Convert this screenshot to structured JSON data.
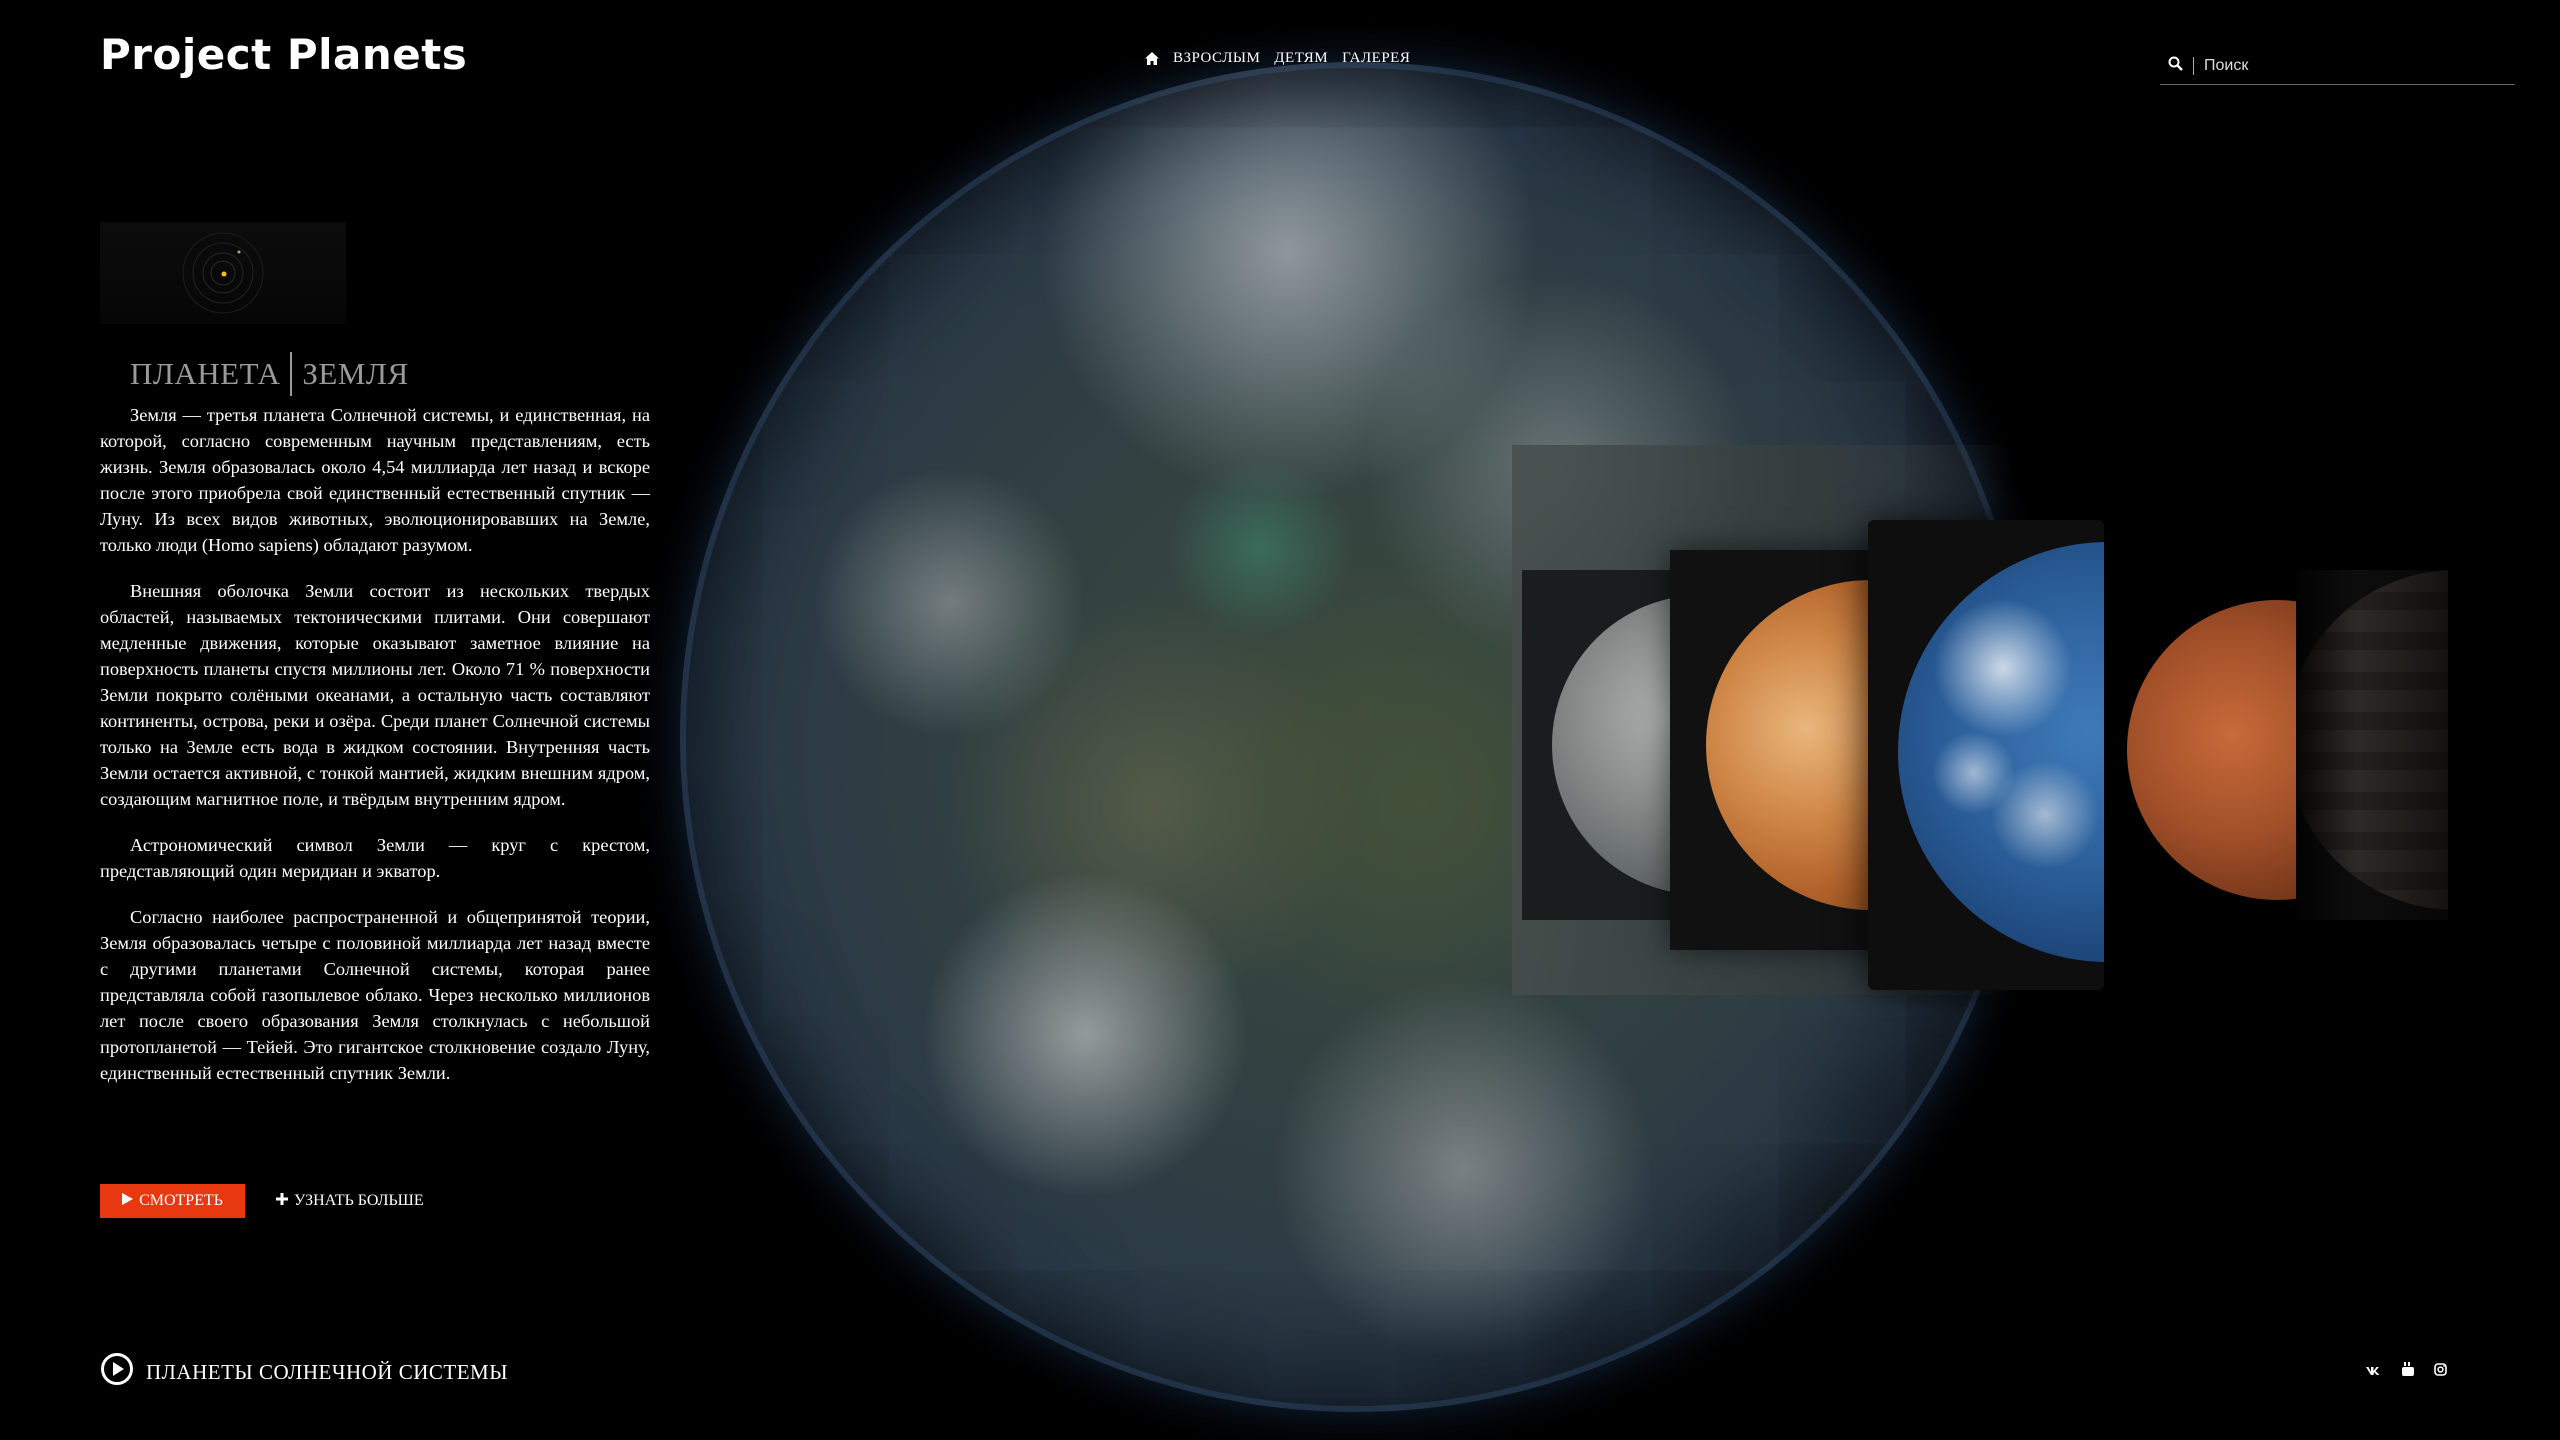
{
  "header": {
    "logo": "Project Planets",
    "nav": [
      "ВЗРОСЛЫМ",
      "ДЕТЯМ",
      "ГАЛЕРЕЯ"
    ],
    "search_placeholder": "Поиск"
  },
  "planet": {
    "label": "ПЛАНЕТА",
    "name": "ЗЕМЛЯ",
    "paragraphs": [
      "Земля — третья планета Солнечной системы, и единственная, на которой, согласно современным научным представлениям, есть жизнь. Земля образовалась около 4,54 миллиарда лет назад и вскоре после этого приобрела свой единственный естественный спутник — Луну. Из всех видов животных, эволюционировавших на Земле, только люди (Homo sapiens) обладают разумом.",
      "Внешняя оболочка Земли состоит из нескольких твердых областей, называемых тектоническими плитами. Они совершают медленные движения, которые оказывают заметное влияние на поверхность планеты спустя миллионы лет. Около 71 % поверхности Земли покрыто солёными океанами, а остальную часть составляют континенты, острова, реки и озёра. Среди планет Солнечной системы только на Земле есть вода в жидком состоянии. Внутренняя часть Земли остается активной, с тонкой мантией, жидким внешним ядром, создающим магнитное поле, и твёрдым внутренним ядром.",
      "Астрономический символ Земли — круг с крестом, представляющий один меридиан и экватор.",
      "Согласно наиболее распространенной и общепринятой теории, Земля образовалась четыре с половиной миллиарда лет назад вместе с другими планетами Солнечной системы, которая ранее представляла собой газопылевое облако. Через несколько миллионов лет после своего образования Земля столкнулась с небольшой протопланетой — Тейей. Это гигантское столкновение создало Луну, единственный естественный спутник Земли."
    ]
  },
  "actions": {
    "watch": "СМОТРЕТЬ",
    "more": "УЗНАТЬ БОЛЬШЕ"
  },
  "footer": {
    "solar_link": "ПЛАНЕТЫ СОЛНЕЧНОЙ СИСТЕМЫ",
    "social": [
      "vk-icon",
      "youtube-icon",
      "instagram-icon"
    ]
  },
  "carousel": [
    "moon",
    "venus",
    "earth",
    "mars",
    "jupiter"
  ],
  "colors": {
    "accent": "#e8380f",
    "background": "#000000",
    "title_gray": "#9a9a9a"
  }
}
